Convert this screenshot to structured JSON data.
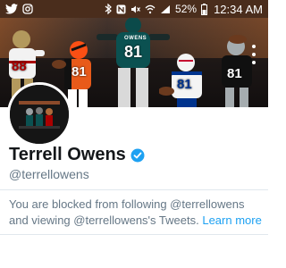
{
  "status_bar": {
    "left_icons": [
      "twitter-icon",
      "instagram-icon"
    ],
    "right_icons": [
      "bluetooth-icon",
      "nfc-icon",
      "mute-icon",
      "wifi-icon",
      "signal-icon",
      "battery-icon"
    ],
    "battery_percent": "52%",
    "time": "12:34 AM",
    "background": "#4a2d1c"
  },
  "header": {
    "banner_players": [
      {
        "name": "",
        "number": "88"
      },
      {
        "name": "",
        "number": "81"
      },
      {
        "name": "OWENS",
        "number": "81"
      },
      {
        "name": "",
        "number": "81"
      },
      {
        "name": "",
        "number": "81"
      }
    ],
    "menu_icon": "more-vertical-icon"
  },
  "profile": {
    "display_name": "Terrell Owens",
    "handle": "@terrellowens",
    "verified": true,
    "verified_color": "#1da1f2"
  },
  "blocked_notice": {
    "message": "You are blocked from following @terrellowens and viewing @terrellowens's Tweets.",
    "link_label": "Learn more",
    "link_color": "#1da1f2"
  }
}
